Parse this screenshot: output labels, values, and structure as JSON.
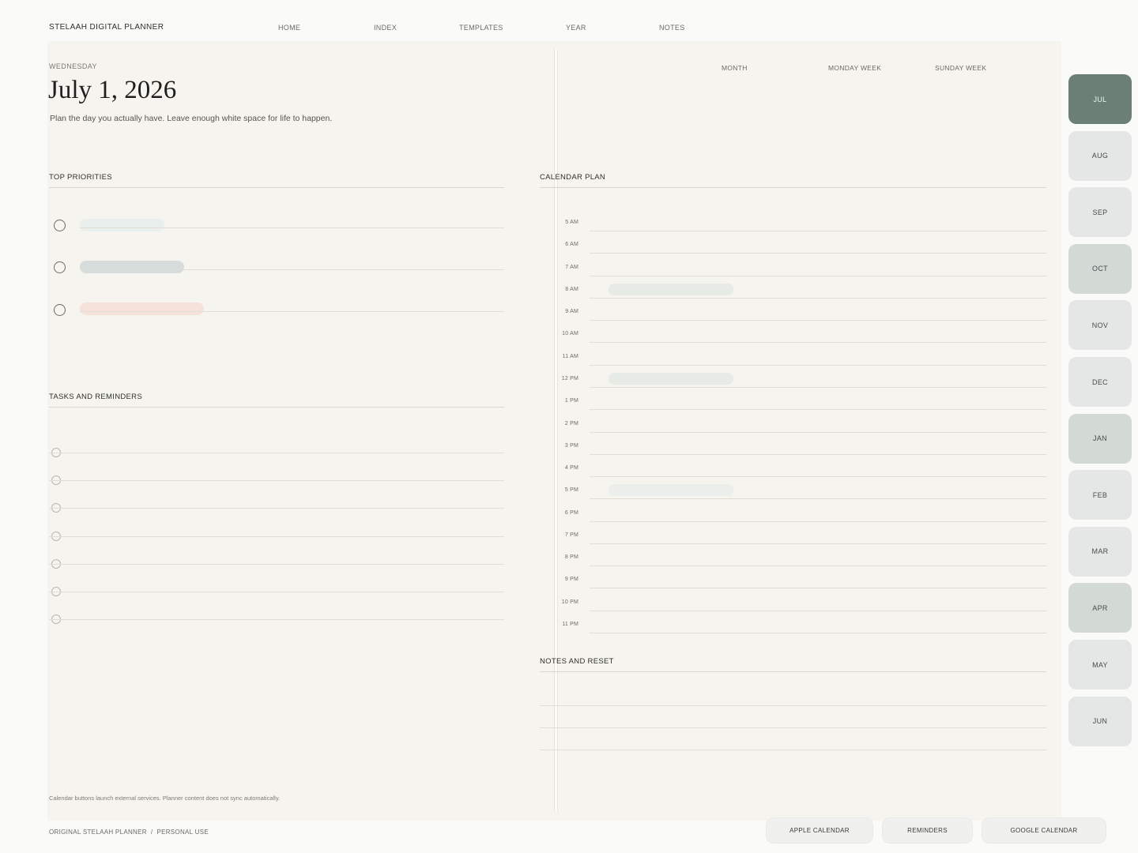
{
  "brand": "STELAAH DIGITAL PLANNER",
  "nav": [
    "HOME",
    "INDEX",
    "TEMPLATES",
    "YEAR",
    "NOTES"
  ],
  "day": {
    "weekday": "WEDNESDAY",
    "date": "July 1, 2026",
    "tagline": "Plan the day you actually have. Leave enough white space for life to happen."
  },
  "views": [
    "MONTH",
    "MONDAY WEEK",
    "SUNDAY WEEK"
  ],
  "sections": {
    "priorities": "TOP PRIORITIES",
    "tasks": "TASKS AND REMINDERS",
    "calendar": "CALENDAR PLAN",
    "notes": "NOTES AND RESET"
  },
  "priority_colors": [
    "#e9efec",
    "#d6dcdb",
    "#f6e2d8"
  ],
  "hours": [
    "5 AM",
    "6 AM",
    "7 AM",
    "8 AM",
    "9 AM",
    "10 AM",
    "11 AM",
    "12 PM",
    "1 PM",
    "2 PM",
    "3 PM",
    "4 PM",
    "5 PM",
    "6 PM",
    "7 PM",
    "8 PM",
    "9 PM",
    "10 PM",
    "11 PM"
  ],
  "footnote": "Calendar buttons launch external services. Planner content does not sync automatically.",
  "footer_left": "ORIGINAL STELAAH PLANNER  /  PERSONAL USE",
  "footer_buttons": [
    "APPLE CALENDAR",
    "REMINDERS",
    "GOOGLE CALENDAR"
  ],
  "months": [
    "JUL",
    "AUG",
    "SEP",
    "OCT",
    "NOV",
    "DEC",
    "JAN",
    "FEB",
    "MAR",
    "APR",
    "MAY",
    "JUN"
  ],
  "active_month": "JUL",
  "colors": {
    "active_tab": "#6b7f76",
    "tab_muted": "#d3dad6",
    "tab_light": "#e4e7e5",
    "paper": "#f6f4ee"
  }
}
